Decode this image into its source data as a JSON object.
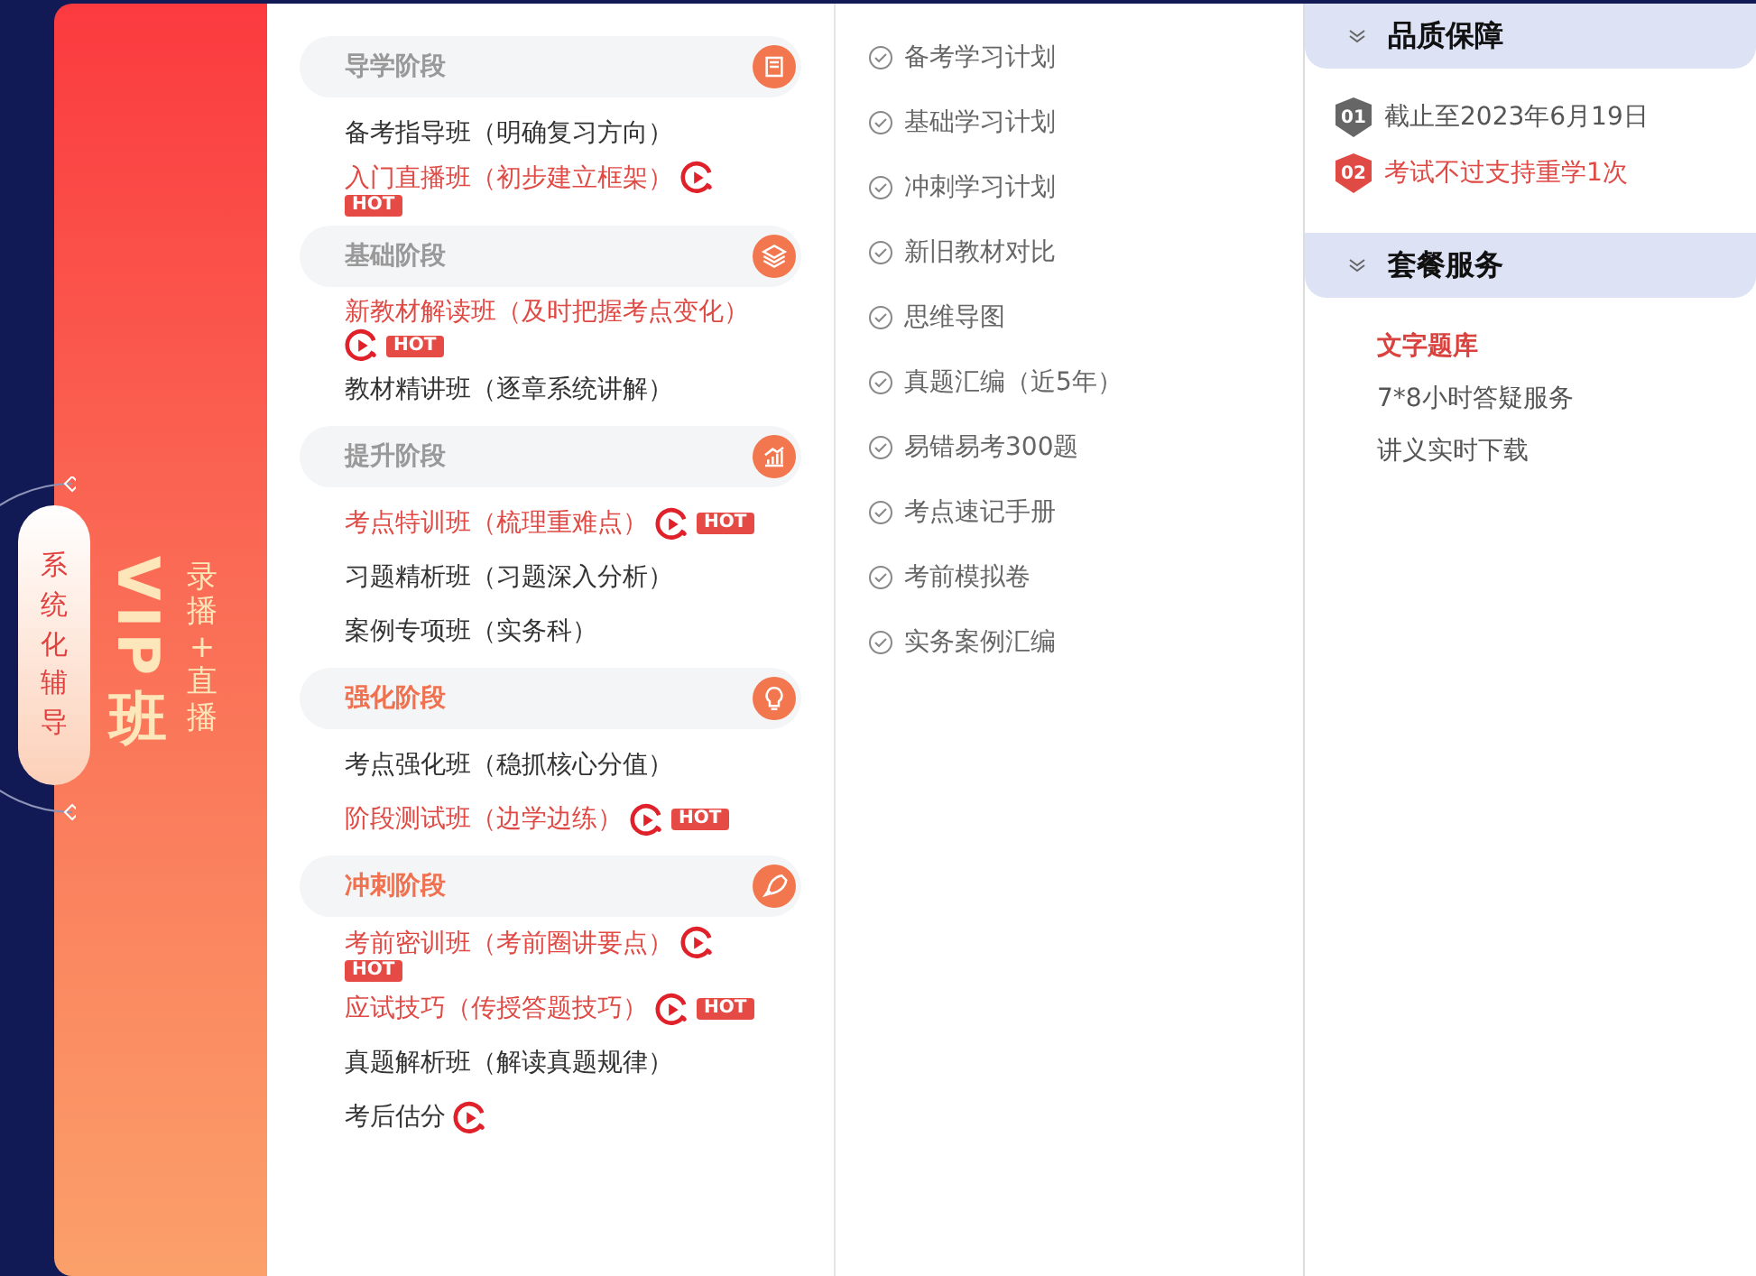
{
  "banner": {
    "side_label": "系统化辅导",
    "title_latin": "VIP",
    "title_cjk": "班",
    "subtitle": "录播+直播"
  },
  "stages": [
    {
      "title": "导学阶段",
      "highlight": false,
      "items": [
        {
          "label": "备考指导班（明确复习方向）",
          "highlight": false,
          "video": false
        },
        {
          "label": "入门直播班（初步建立框架）",
          "highlight": true,
          "video": true,
          "hot": "HOT"
        }
      ]
    },
    {
      "title": "基础阶段",
      "highlight": false,
      "items": [
        {
          "label": "新教材解读班（及时把握考点变化）",
          "highlight": true,
          "video": true,
          "hot": "HOT"
        },
        {
          "label": "教材精讲班（逐章系统讲解）",
          "highlight": false,
          "video": false
        }
      ]
    },
    {
      "title": "提升阶段",
      "highlight": false,
      "items": [
        {
          "label": "考点特训班（梳理重难点）",
          "highlight": true,
          "video": true,
          "hot": "HOT"
        },
        {
          "label": "习题精析班（习题深入分析）",
          "highlight": false,
          "video": false
        },
        {
          "label": "案例专项班（实务科）",
          "highlight": false,
          "video": false
        }
      ]
    },
    {
      "title": "强化阶段",
      "highlight": true,
      "items": [
        {
          "label": "考点强化班（稳抓核心分值）",
          "highlight": false,
          "video": false
        },
        {
          "label": "阶段测试班（边学边练）",
          "highlight": true,
          "video": true,
          "hot": "HOT"
        }
      ]
    },
    {
      "title": "冲刺阶段",
      "highlight": true,
      "items": [
        {
          "label": "考前密训班（考前圈讲要点）",
          "highlight": true,
          "video": true,
          "hot": "HOT"
        },
        {
          "label": "应试技巧（传授答题技巧）",
          "highlight": true,
          "video": true,
          "hot": "HOT"
        },
        {
          "label": "真题解析班（解读真题规律）",
          "highlight": false,
          "video": false
        },
        {
          "label": "考后估分",
          "highlight": false,
          "video": true
        }
      ]
    }
  ],
  "materials": [
    "备考学习计划",
    "基础学习计划",
    "冲刺学习计划",
    "新旧教材对比",
    "思维导图",
    "真题汇编（近5年）",
    "易错易考300题",
    "考点速记手册",
    "考前模拟卷",
    "实务案例汇编"
  ],
  "quality": {
    "title": "品质保障",
    "items": [
      {
        "badge": "01",
        "text": "截止至2023年6月19日",
        "highlight": false
      },
      {
        "badge": "02",
        "text": "考试不过支持重学1次",
        "highlight": true
      }
    ]
  },
  "services": {
    "title": "套餐服务",
    "items": [
      {
        "text": "文字题库",
        "highlight": true
      },
      {
        "text": "7*8小时答疑服务",
        "highlight": false
      },
      {
        "text": "讲义实时下载",
        "highlight": false
      }
    ]
  }
}
